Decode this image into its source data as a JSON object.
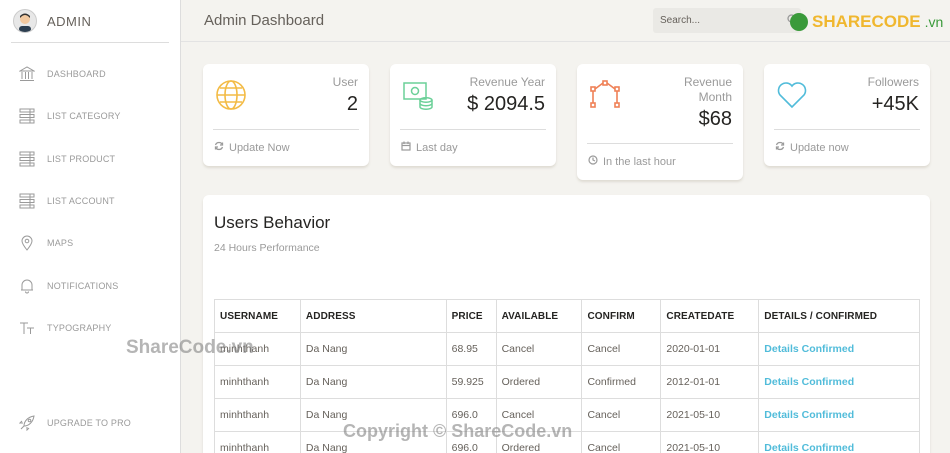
{
  "sidebar": {
    "brand": "ADMIN",
    "items": [
      {
        "label": "DASHBOARD",
        "icon": "bank-icon"
      },
      {
        "label": "LIST CATEGORY",
        "icon": "list-icon"
      },
      {
        "label": "LIST PRODUCT",
        "icon": "list-icon"
      },
      {
        "label": "LIST ACCOUNT",
        "icon": "list-icon"
      },
      {
        "label": "MAPS",
        "icon": "pin-icon"
      },
      {
        "label": "NOTIFICATIONS",
        "icon": "bell-icon"
      },
      {
        "label": "TYPOGRAPHY",
        "icon": "text-icon"
      }
    ],
    "upgrade": "UPGRADE TO PRO"
  },
  "header": {
    "title": "Admin Dashboard",
    "search_placeholder": "Search..."
  },
  "stats": [
    {
      "category": "User",
      "value": "2",
      "footer": "Update Now"
    },
    {
      "category": "Revenue Year",
      "value": "$ 2094.5",
      "footer": "Last day"
    },
    {
      "category": "Revenue Month",
      "value": "$68",
      "footer": "In the last hour"
    },
    {
      "category": "Followers",
      "value": "+45K",
      "footer": "Update now"
    }
  ],
  "table": {
    "title": "Users Behavior",
    "subtitle": "24 Hours Performance",
    "headers": [
      "USERNAME",
      "ADDRESS",
      "PRICE",
      "AVAILABLE",
      "CONFIRM",
      "CREATEDATE",
      "DETAILS / CONFIRMED"
    ],
    "rows": [
      [
        "minhthanh",
        "Da Nang",
        "68.95",
        "Cancel",
        "Cancel",
        "2020-01-01",
        "Details Confirmed"
      ],
      [
        "minhthanh",
        "Da Nang",
        "59.925",
        "Ordered",
        "Confirmed",
        "2012-01-01",
        "Details Confirmed"
      ],
      [
        "minhthanh",
        "Da Nang",
        "696.0",
        "Cancel",
        "Cancel",
        "2021-05-10",
        "Details Confirmed"
      ],
      [
        "minhthanh",
        "Da Nang",
        "696.0",
        "Ordered",
        "Cancel",
        "2021-05-10",
        "Details Confirmed"
      ]
    ]
  },
  "watermark": {
    "logo": "SHARECODE",
    "logo_domain": ".vn",
    "overlay": "ShareCode.vn",
    "copyright": "Copyright © ShareCode.vn"
  },
  "colors": {
    "background": "#f4f3ef",
    "link": "#51bcda",
    "icon_warning": "#f3bb45",
    "icon_success": "#6bd098",
    "icon_danger": "#ef8157",
    "icon_info": "#51bcda"
  }
}
